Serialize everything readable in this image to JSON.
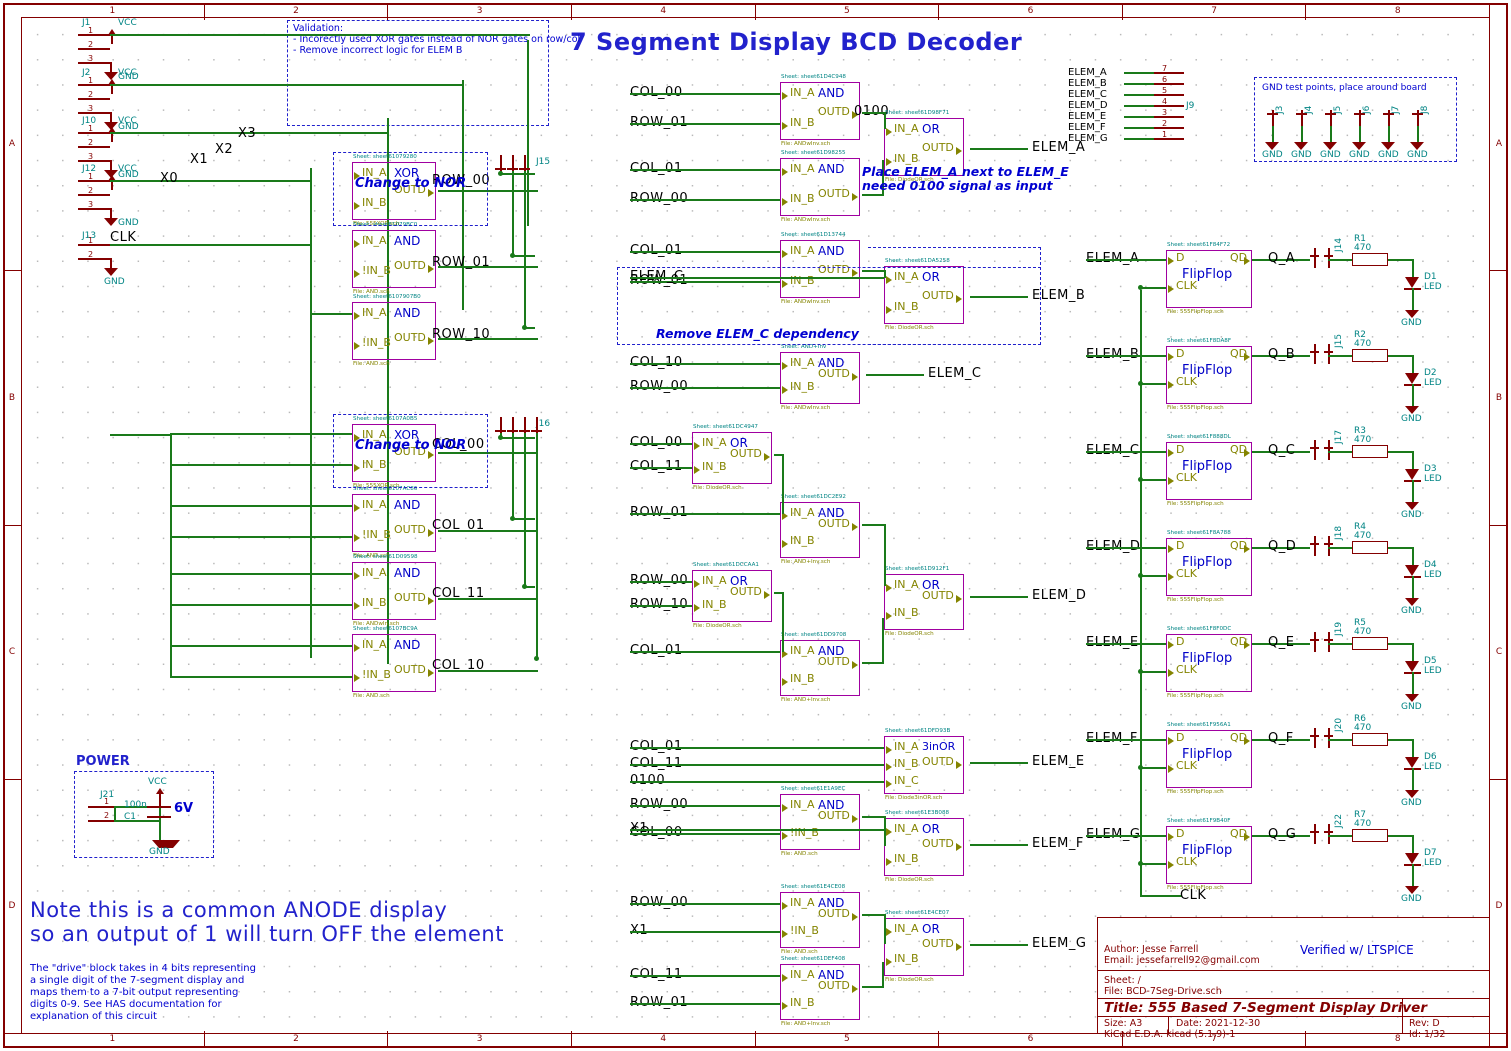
{
  "sheet": {
    "title": "7 Segment Display BCD Decoder",
    "ruler_top": [
      "1",
      "2",
      "3",
      "4",
      "5",
      "6",
      "7",
      "8"
    ],
    "ruler_bottom": [
      "1",
      "2",
      "3",
      "4",
      "5",
      "6",
      "7",
      "8"
    ],
    "ruler_left": [
      "A",
      "B",
      "C",
      "D"
    ],
    "ruler_right": [
      "A",
      "B",
      "C",
      "D"
    ]
  },
  "validation_note": {
    "line1": "Validation:",
    "line2": "- Incorectly used XOR gates instead of NOR gates on row/col",
    "line3": "- Remove incorrect logic for ELEM B"
  },
  "notes": {
    "elem_a_note_l1": "Place ELEM_A next to ELEM_E",
    "elem_a_note_l2": "neeed 0100 signal as input",
    "elem_c_note": "Remove ELEM_C dependency",
    "change_to_nor": "Change to NOR",
    "gnd_testpoints": "GND test points, place around board",
    "anode_l1": "Note this is a common ANODE display",
    "anode_l2": "so an output of 1 will turn OFF the element",
    "drive_l1": "The \"drive\" block takes in 4 bits representing",
    "drive_l2": "a single digit of the 7-segment display and",
    "drive_l3": "maps them to a 7-bit output representing",
    "drive_l4": "digits 0-9. See HAS documentation for",
    "drive_l5": "explanation of this circuit"
  },
  "power_block": {
    "title": "POWER",
    "connector": "J21",
    "pin1": "1",
    "pin2": "2",
    "cap_value": "100n",
    "cap_ref": "C1",
    "supply": "6V",
    "vcc": "VCC",
    "gnd": "GND"
  },
  "input_connectors": [
    {
      "ref": "J1",
      "vcc": "VCC",
      "gnd": "GND",
      "pins": [
        "1",
        "2",
        "3"
      ]
    },
    {
      "ref": "J2",
      "vcc": "VCC",
      "gnd": "GND",
      "pins": [
        "1",
        "2",
        "3"
      ]
    },
    {
      "ref": "J10",
      "vcc": "VCC",
      "gnd": "GND",
      "pins": [
        "1",
        "2",
        "3"
      ]
    },
    {
      "ref": "J12",
      "vcc": "VCC",
      "gnd": "GND",
      "pins": [
        "1",
        "2",
        "3"
      ]
    },
    {
      "ref": "J13",
      "label": "CLK",
      "gnd": "GND",
      "pins": [
        "1",
        "2"
      ]
    }
  ],
  "bit_labels": [
    "X0",
    "X1",
    "X2",
    "X3"
  ],
  "left_gates": [
    {
      "sheet": "Sheet: sheet61079280",
      "file": "File: 555XOR.sch",
      "type": "XOR",
      "in_a": "IN_A",
      "in_b": "IN_B",
      "out": "OUTD",
      "net": "ROW_00"
    },
    {
      "sheet": "Sheet: sheet61079BC0",
      "file": "File: AND.sch",
      "type": "AND",
      "in_a": "IN_A",
      "in_b": "!IN_B",
      "out": "OUTD",
      "net": "ROW_01"
    },
    {
      "sheet": "Sheet: sheet6107907B0",
      "file": "File: AND.sch",
      "type": "AND",
      "in_a": "IN_A",
      "in_b": "!IN_B",
      "out": "OUTD",
      "net": "ROW_10"
    },
    {
      "sheet": "Sheet: sheet6107A0B5",
      "file": "File: 555XOR.sch",
      "type": "XOR",
      "in_a": "IN_A",
      "in_b": "IN_B",
      "out": "OUTD",
      "net": "COL_00"
    },
    {
      "sheet": "Sheet: sheet6107AC86",
      "file": "File: AND.sch",
      "type": "AND",
      "in_a": "IN_A",
      "in_b": "!IN_B",
      "out": "OUTD",
      "net": "COL_01"
    },
    {
      "sheet": "Sheet: sheet61D09598",
      "file": "File: ANDwIn.sch",
      "type": "AND",
      "in_a": "IN_A",
      "in_b": "IN_B",
      "out": "OUTD",
      "net": "COL_11"
    },
    {
      "sheet": "Sheet: sheet6107BC9A",
      "file": "File: AND.sch",
      "type": "AND",
      "in_a": "IN_A",
      "in_b": "!IN_B",
      "out": "OUTD",
      "net": "COL_10"
    }
  ],
  "row_connectors": [
    {
      "ref": "J15"
    },
    {
      "ref": "J16"
    }
  ],
  "middle_gates": [
    {
      "id": "g_a1",
      "sheet": "Sheet: sheet61D4C948",
      "file": "File: ANDwInv.sch",
      "type": "AND",
      "in_a": "IN_A",
      "in_b": "IN_B",
      "out": "OUTD",
      "inputs": [
        "COL_00",
        "ROW_01"
      ],
      "out_net": "0100"
    },
    {
      "id": "g_a2",
      "sheet": "Sheet: sheet61D98255",
      "file": "File: ANDwInv.sch",
      "type": "AND",
      "in_a": "IN_A",
      "in_b": "IN_B",
      "out": "OUTD",
      "inputs": [
        "COL_01",
        "ROW_00"
      ],
      "out_net": ""
    },
    {
      "id": "g_a3",
      "sheet": "Sheet: sheet61D98F71",
      "file": "File: DiodeOR.sch",
      "type": "OR",
      "in_a": "IN_A",
      "in_b": "IN_B",
      "out": "OUTD",
      "inputs": [],
      "out_net": "ELEM_A"
    },
    {
      "id": "g_b1",
      "sheet": "Sheet: sheet61D13744",
      "file": "File: ANDwInv.sch",
      "type": "AND",
      "in_a": "IN_A",
      "in_b": "IN_B",
      "out": "OUTD",
      "inputs": [
        "COL_01",
        "ROW_01"
      ],
      "out_net": ""
    },
    {
      "id": "g_b2",
      "sheet": "Sheet: sheet61DA5258",
      "file": "File: DiodeOR.sch",
      "type": "OR",
      "in_a": "IN_A",
      "in_b": "IN_B",
      "out": "OUTD",
      "inputs": [
        "ELEM_C"
      ],
      "out_net": "ELEM_B"
    },
    {
      "id": "g_c1",
      "sheet": "Sheet: AND+Inv",
      "file": "File: ANDwInv.sch",
      "type": "AND",
      "in_a": "IN_A",
      "in_b": "IN_B",
      "out": "OUTD",
      "inputs": [
        "COL_10",
        "ROW_00"
      ],
      "out_net": "ELEM_C"
    },
    {
      "id": "g_d1",
      "sheet": "Sheet: sheet61DC4947",
      "file": "File: DiodeOR.sch",
      "type": "OR",
      "in_a": "IN_A",
      "in_b": "IN_B",
      "out": "OUTD",
      "inputs": [
        "COL_00",
        "COL_11"
      ],
      "out_net": ""
    },
    {
      "id": "g_d2",
      "sheet": "Sheet: sheet61DC2E92",
      "file": "File: AND+Inv.sch",
      "type": "AND",
      "in_a": "IN_A",
      "in_b": "IN_B",
      "out": "OUTD",
      "inputs": [
        "ROW_01"
      ],
      "out_net": ""
    },
    {
      "id": "g_d3",
      "sheet": "Sheet: sheet61DCCAA1",
      "file": "File: DiodeOR.sch",
      "type": "OR",
      "in_a": "IN_A",
      "in_b": "IN_B",
      "out": "OUTD",
      "inputs": [
        "ROW_00",
        "ROW_10"
      ],
      "out_net": ""
    },
    {
      "id": "g_d4",
      "sheet": "Sheet: sheet61DD9708",
      "file": "File: AND+Inv.sch",
      "type": "AND",
      "in_a": "IN_A",
      "in_b": "IN_B",
      "out": "OUTD",
      "inputs": [
        "COL_01"
      ],
      "out_net": ""
    },
    {
      "id": "g_d5",
      "sheet": "Sheet: sheet61D912F1",
      "file": "File: DiodeOR.sch",
      "type": "OR",
      "in_a": "IN_A",
      "in_b": "IN_B",
      "out": "OUTD",
      "inputs": [],
      "out_net": "ELEM_D"
    },
    {
      "id": "g_e1",
      "sheet": "Sheet: sheet61DFD93B",
      "file": "File: Diode3inOR.sch",
      "type": "3inOR",
      "in_a": "IN_A",
      "in_b": "IN_B",
      "in_c": "IN_C",
      "out": "OUTD",
      "inputs": [
        "COL_01",
        "COL_11",
        "0100"
      ],
      "out_net": "ELEM_E"
    },
    {
      "id": "g_f1",
      "sheet": "Sheet: sheet61E1A9EC",
      "file": "File: AND.sch",
      "type": "AND",
      "in_a": "IN_A",
      "in_b": "!IN_B",
      "out": "OUTD",
      "inputs": [
        "ROW_00",
        "COL_00"
      ],
      "out_net": ""
    },
    {
      "id": "g_f2",
      "sheet": "Sheet: sheet61E3B088",
      "file": "File: DiodeOR.sch",
      "type": "OR",
      "in_a": "IN_A",
      "in_b": "IN_B",
      "out": "OUTD",
      "inputs": [
        "X1"
      ],
      "out_net": "ELEM_F"
    },
    {
      "id": "g_g1",
      "sheet": "Sheet: sheet61E4CE08",
      "file": "File: AND.sch",
      "type": "AND",
      "in_a": "IN_A",
      "in_b": "!IN_B",
      "out": "OUTD",
      "inputs": [
        "ROW_00",
        "X1"
      ],
      "out_net": ""
    },
    {
      "id": "g_g2",
      "sheet": "Sheet: sheet61DEF408",
      "file": "File: AND+Inv.sch",
      "type": "AND",
      "in_a": "IN_A",
      "in_b": "IN_B",
      "out": "OUTD",
      "inputs": [
        "COL_11",
        "ROW_01"
      ],
      "out_net": ""
    },
    {
      "id": "g_g3",
      "sheet": "Sheet: sheet61E4CE07",
      "file": "File: DiodeOR.sch",
      "type": "OR",
      "in_a": "IN_A",
      "in_b": "IN_B",
      "out": "OUTD",
      "inputs": [],
      "out_net": "ELEM_G"
    }
  ],
  "elem_connector": {
    "ref": "J9",
    "rows": [
      {
        "label": "ELEM_A",
        "pin": "7"
      },
      {
        "label": "ELEM_B",
        "pin": "6"
      },
      {
        "label": "ELEM_C",
        "pin": "5"
      },
      {
        "label": "ELEM_D",
        "pin": "4"
      },
      {
        "label": "ELEM_E",
        "pin": "3"
      },
      {
        "label": "ELEM_F",
        "pin": "2"
      },
      {
        "label": "ELEM_G",
        "pin": "1"
      }
    ]
  },
  "gnd_testpoints": {
    "title": "GND test points, place around board",
    "refs": [
      "J3",
      "J4",
      "J5",
      "J6",
      "J7",
      "J8"
    ],
    "gnd_label": "GND"
  },
  "flipflops": [
    {
      "sheet": "Sheet: sheet61F84F72",
      "file": "File: 555FlipFlop.sch",
      "in": "ELEM_A",
      "d": "D",
      "q": "QD",
      "clk": "CLK",
      "type": "FlipFlop",
      "out_net": "Q_A",
      "conn": "J14",
      "res_ref": "R1",
      "res_val": "470",
      "led_ref": "D1",
      "led": "LED",
      "gnd": "GND"
    },
    {
      "sheet": "Sheet: sheet61F8DA8F",
      "file": "File: 555FlipFlop.sch",
      "in": "ELEM_B",
      "d": "D",
      "q": "QD",
      "clk": "CLK",
      "type": "FlipFlop",
      "out_net": "Q_B",
      "conn": "J15",
      "res_ref": "R2",
      "res_val": "470",
      "led_ref": "D2",
      "led": "LED",
      "gnd": "GND"
    },
    {
      "sheet": "Sheet: sheet61F888DL",
      "file": "File: 555FlipFlop.sch",
      "in": "ELEM_C",
      "d": "D",
      "q": "QD",
      "clk": "CLK",
      "type": "FlipFlop",
      "out_net": "Q_C",
      "conn": "J17",
      "res_ref": "R3",
      "res_val": "470",
      "led_ref": "D3",
      "led": "LED",
      "gnd": "GND"
    },
    {
      "sheet": "Sheet: sheet61F8A788",
      "file": "File: 555FlipFlop.sch",
      "in": "ELEM_D",
      "d": "D",
      "q": "QD",
      "clk": "CLK",
      "type": "FlipFlop",
      "out_net": "Q_D",
      "conn": "J18",
      "res_ref": "R4",
      "res_val": "470",
      "led_ref": "D4",
      "led": "LED",
      "gnd": "GND"
    },
    {
      "sheet": "Sheet: sheet61F8F0DC",
      "file": "File: 555FlipFlop.sch",
      "in": "ELEM_E",
      "d": "D",
      "q": "QD",
      "clk": "CLK",
      "type": "FlipFlop",
      "out_net": "Q_E",
      "conn": "J19",
      "res_ref": "R5",
      "res_val": "470",
      "led_ref": "D5",
      "led": "LED",
      "gnd": "GND"
    },
    {
      "sheet": "Sheet: sheet61F956A1",
      "file": "File: 555FlipFlop.sch",
      "in": "ELEM_F",
      "d": "D",
      "q": "QD",
      "clk": "CLK",
      "type": "FlipFlop",
      "out_net": "Q_F",
      "conn": "J20",
      "res_ref": "R6",
      "res_val": "470",
      "led_ref": "D6",
      "led": "LED",
      "gnd": "GND"
    },
    {
      "sheet": "Sheet: sheet61F9B40F",
      "file": "File: 555FlipFlop.sch",
      "in": "ELEM_G",
      "d": "D",
      "q": "QD",
      "clk": "CLK",
      "type": "FlipFlop",
      "out_net": "Q_G",
      "conn": "J22",
      "res_ref": "R7",
      "res_val": "470",
      "led_ref": "D7",
      "led": "LED",
      "gnd": "GND"
    }
  ],
  "clk_net": "CLK",
  "title_block": {
    "author": "Author: Jesse Farrell",
    "email": "Email: jessefarrell92@gmail.com",
    "verified": "Verified w/ LTSPICE",
    "sheet": "Sheet: /",
    "file": "File: BCD-7Seg-Drive.sch",
    "title": "Title: 555 Based 7-Segment Display Driver",
    "size": "Size: A3",
    "date": "Date: 2021-12-30",
    "rev": "Rev: D",
    "eda": "KiCad E.D.A.   kicad (5.1.9)-1",
    "id": "Id: 1/32"
  }
}
